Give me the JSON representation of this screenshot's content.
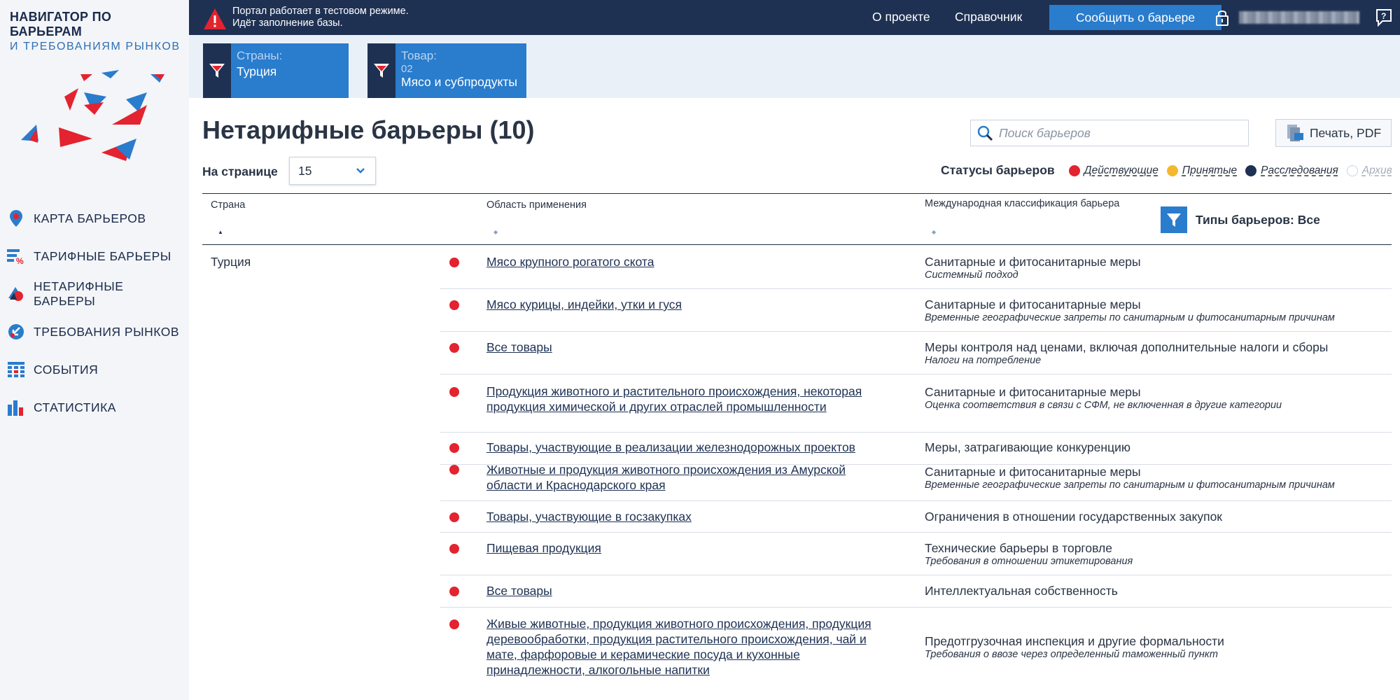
{
  "logo": {
    "line1": "НАВИГАТОР ПО БАРЬЕРАМ",
    "line2": "И ТРЕБОВАНИЯМ РЫНКОВ"
  },
  "nav": [
    {
      "label": "КАРТА БАРЬЕРОВ",
      "icon": "map-pin-icon"
    },
    {
      "label": "ТАРИФНЫЕ БАРЬЕРЫ",
      "icon": "tariff-percent-icon"
    },
    {
      "label": "НЕТАРИФНЫЕ БАРЬЕРЫ",
      "icon": "nontariff-shapes-icon"
    },
    {
      "label": "ТРЕБОВАНИЯ РЫНКОВ",
      "icon": "market-arrow-icon"
    },
    {
      "label": "СОБЫТИЯ",
      "icon": "calendar-grid-icon"
    },
    {
      "label": "СТАТИСТИКА",
      "icon": "bar-stats-icon"
    }
  ],
  "topbar": {
    "warning_line1": "Портал работает в тестовом режиме.",
    "warning_line2": "Идёт заполнение базы.",
    "about": "О проекте",
    "reference": "Справочник",
    "report_button": "Сообщить о барьере"
  },
  "filters": {
    "countries": {
      "label": "Страны:",
      "value": "Турция"
    },
    "product": {
      "label": "Товар:",
      "code": "02",
      "value": "Мясо и субпродукты"
    }
  },
  "main": {
    "title": "Нетарифные барьеры (10)",
    "search_placeholder": "Поиск барьеров",
    "print_label": "Печать, PDF",
    "per_page_label": "На странице",
    "per_page_value": "15",
    "statuses_title": "Статусы барьеров",
    "statuses": [
      {
        "label": "Действующие",
        "color": "#e3232f"
      },
      {
        "label": "Принятые",
        "color": "#f4b82f"
      },
      {
        "label": "Расследования",
        "color": "#1e3153"
      },
      {
        "label": "Архив",
        "color": "#ffffff"
      }
    ]
  },
  "table": {
    "col_country": "Страна",
    "col_area": "Область применения",
    "col_class": "Международная классификация барьера",
    "types_filter": "Типы барьеров:  Все",
    "country": "Турция",
    "rows": [
      {
        "area": "Мясо крупного рогатого скота",
        "cls": "Санитарные и фитосанитарные меры",
        "sub": "Системный подход"
      },
      {
        "area": "Мясо курицы, индейки, утки и гуся",
        "cls": "Санитарные и фитосанитарные меры",
        "sub": "Временные географические запреты по санитарным и фитосанитарным причинам"
      },
      {
        "area": "Все товары",
        "cls": "Меры контроля над ценами, включая дополнительные налоги и сборы",
        "sub": "Налоги на потребление"
      },
      {
        "area": "Продукция животного и растительного происхождения, некоторая продукция химической и других отраслей промышленности",
        "cls": "Санитарные и фитосанитарные меры",
        "sub": "Оценка соответствия в связи с СФМ, не включенная в другие категории"
      },
      {
        "area": "Товары, участвующие в реализации железнодорожных проектов",
        "cls": "Меры, затрагивающие конкуренцию",
        "sub": ""
      },
      {
        "area": "Животные и продукция животного происхождения из Амурской области и Краснодарского края",
        "cls": "Санитарные и фитосанитарные меры",
        "sub": "Временные географические запреты по санитарным и фитосанитарным причинам"
      },
      {
        "area": "Товары, участвующие в госзакупках",
        "cls": "Ограничения в отношении государственных закупок",
        "sub": ""
      },
      {
        "area": "Пищевая продукция",
        "cls": "Технические барьеры в торговле",
        "sub": "Требования в отношении этикетирования"
      },
      {
        "area": "Все товары",
        "cls": "Интеллектуальная собственность",
        "sub": ""
      },
      {
        "area": "Живые животные, продукция животного происхождения, продукция деревообработки, продукция растительного происхождения, чай и мате, фарфоровые и керамические посуда и кухонные принадлежности, алкогольные напитки",
        "cls": "Предотгрузочная инспекция и другие формальности",
        "sub": "Требования о ввозе через определенный таможенный пункт"
      }
    ]
  }
}
